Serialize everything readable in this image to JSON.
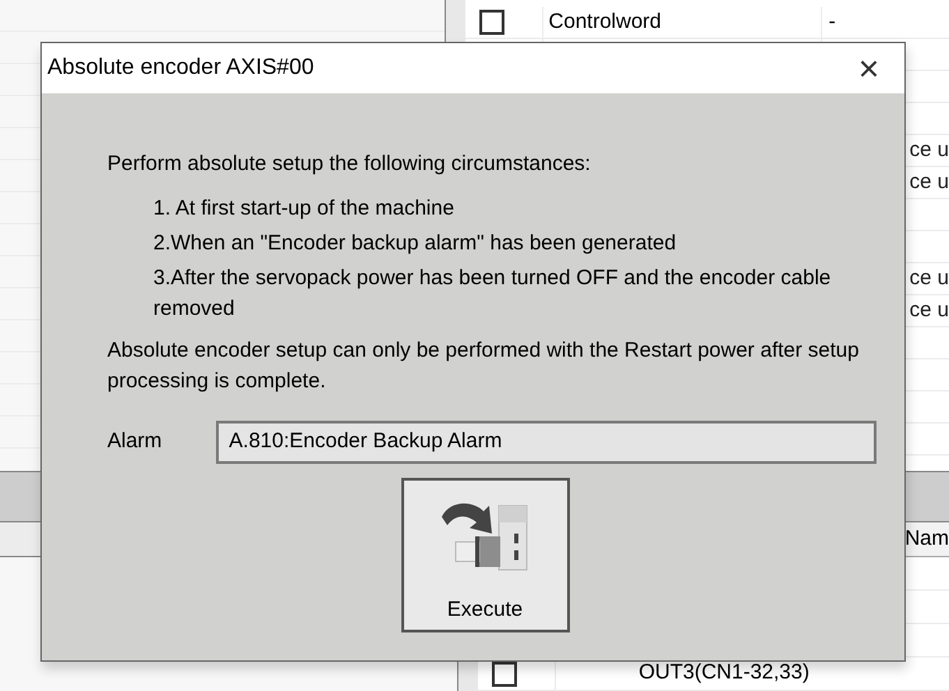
{
  "upper_table": {
    "rows": [
      {
        "checked": false,
        "name": "Controlword",
        "value": "-"
      }
    ],
    "partial_cells": [
      "ce u",
      "ce u",
      "ce u",
      "ce u"
    ]
  },
  "lower_table": {
    "header": "Nam",
    "rows": [
      {
        "checked": false,
        "name": "OUT3(CN1-32,33)"
      }
    ]
  },
  "dialog": {
    "title": "Absolute encoder AXIS#00",
    "close": "×",
    "intro": "Perform absolute setup the following circumstances:",
    "items": [
      "1. At first start-up of the machine",
      "2.When an \"Encoder backup alarm\" has been generated",
      "3.After the servopack power has been turned OFF and the encoder cable removed"
    ],
    "note": "Absolute encoder setup can only be performed with the Restart power after setup processing is complete.",
    "alarm": {
      "label": "Alarm",
      "value": "A.810:Encoder Backup Alarm"
    },
    "execute_button": "Execute"
  }
}
